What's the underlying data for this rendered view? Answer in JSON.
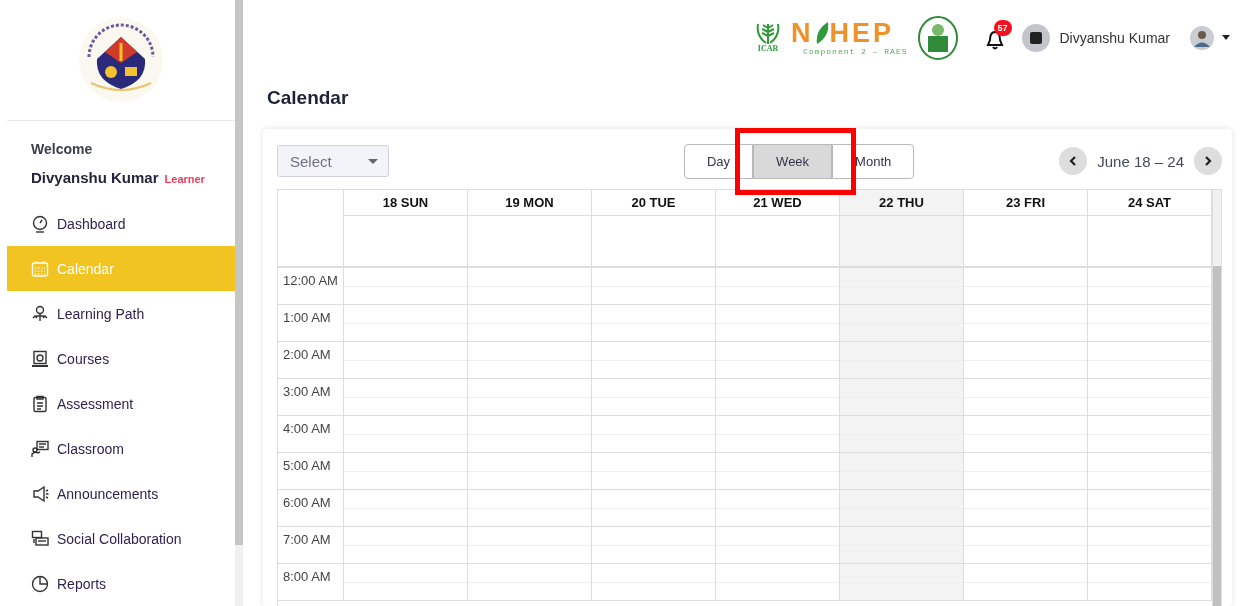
{
  "sidebar": {
    "welcome": "Welcome",
    "user_name": "Divyanshu Kumar",
    "role": "Learner",
    "items": [
      {
        "label": "Dashboard",
        "selected": false
      },
      {
        "label": "Calendar",
        "selected": true
      },
      {
        "label": "Learning Path",
        "selected": false
      },
      {
        "label": "Courses",
        "selected": false
      },
      {
        "label": "Assessment",
        "selected": false
      },
      {
        "label": "Classroom",
        "selected": false
      },
      {
        "label": "Announcements",
        "selected": false
      },
      {
        "label": "Social Collaboration",
        "selected": false
      },
      {
        "label": "Reports",
        "selected": false
      }
    ]
  },
  "header": {
    "logo_texts": {
      "icar": "ICAR",
      "nahep_left": "N",
      "nahep_right": "HEP",
      "component": "Component 2 – RAES"
    },
    "notification_count": "57",
    "user_name": "Divyanshu Kumar"
  },
  "page_title": "Calendar",
  "calendar": {
    "select": {
      "placeholder": "Select"
    },
    "view_buttons": [
      {
        "label": "Day",
        "selected": false,
        "highlighted": false
      },
      {
        "label": "Week",
        "selected": true,
        "highlighted": true
      },
      {
        "label": "Month",
        "selected": false,
        "highlighted": false
      }
    ],
    "range": "June 18 – 24",
    "days": [
      {
        "label": "18 SUN",
        "today": false
      },
      {
        "label": "19 MON",
        "today": false
      },
      {
        "label": "20 TUE",
        "today": false
      },
      {
        "label": "21 WED",
        "today": false
      },
      {
        "label": "22 THU",
        "today": true
      },
      {
        "label": "23 FRI",
        "today": false
      },
      {
        "label": "24 SAT",
        "today": false
      }
    ],
    "times": [
      "12:00 AM",
      "1:00 AM",
      "2:00 AM",
      "3:00 AM",
      "4:00 AM",
      "5:00 AM",
      "6:00 AM",
      "7:00 AM",
      "8:00 AM"
    ]
  }
}
